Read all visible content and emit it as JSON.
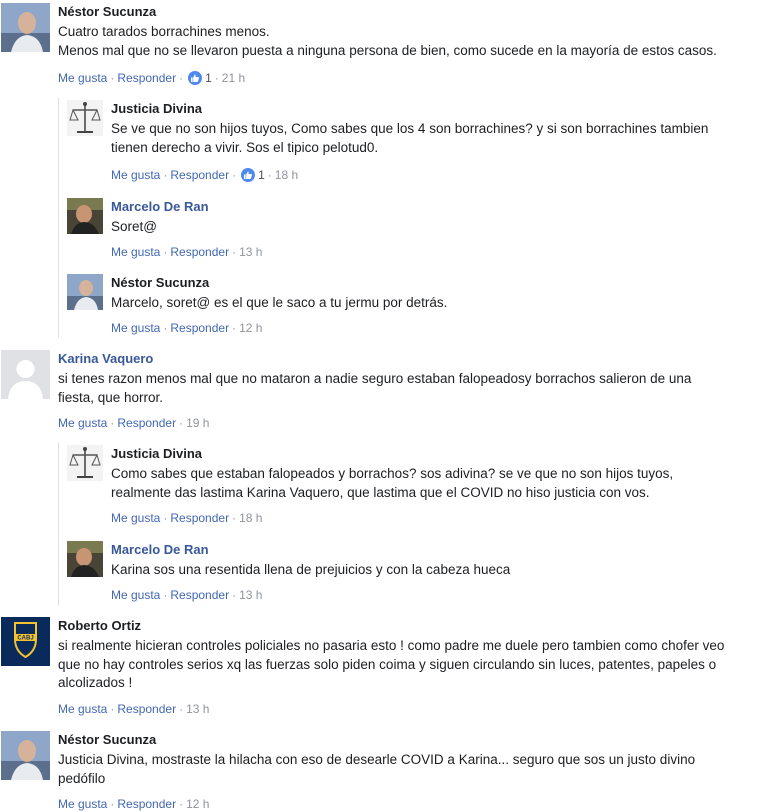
{
  "comments": [
    {
      "author": "Néstor Sucunza",
      "lines": [
        "Cuatro tarados borrachines menos.",
        "Menos mal que no se llevaron puesta a ninguna persona de bien, como sucede en la mayoría de estos casos."
      ],
      "like": "Me gusta",
      "reply": "Responder",
      "reactions": "1",
      "time": "21 h"
    },
    {
      "author": "Justicia Divina",
      "lines": [
        "Se ve que no son hijos tuyos, Como sabes que los 4 son borrachines? y si son borrachines tambien",
        "tienen derecho a vivir. Sos el tipico pelotud0."
      ],
      "like": "Me gusta",
      "reply": "Responder",
      "reactions": "1",
      "time": "18 h"
    },
    {
      "author": "Marcelo De Ran",
      "lines": [
        "Soret@"
      ],
      "like": "Me gusta",
      "reply": "Responder",
      "time": "13 h"
    },
    {
      "author": "Néstor Sucunza",
      "lines": [
        "Marcelo, soret@ es el que le saco a tu jermu por detrás."
      ],
      "like": "Me gusta",
      "reply": "Responder",
      "time": "12 h"
    },
    {
      "author": "Karina Vaquero",
      "lines": [
        "si tenes razon menos mal que no mataron a nadie seguro estaban falopeadosy borrachos salieron de una",
        "fiesta, que horror."
      ],
      "like": "Me gusta",
      "reply": "Responder",
      "time": "19 h"
    },
    {
      "author": "Justicia Divina",
      "lines": [
        "Como sabes que estaban falopeados y borrachos? sos adivina? se ve que no son hijos tuyos,",
        "realmente das lastima Karina Vaquero, que lastima que el COVID no hiso justicia con vos."
      ],
      "like": "Me gusta",
      "reply": "Responder",
      "time": "18 h"
    },
    {
      "author": "Marcelo De Ran",
      "lines": [
        "Karina sos una resentida llena de prejuicios y con la cabeza hueca"
      ],
      "like": "Me gusta",
      "reply": "Responder",
      "time": "13 h"
    },
    {
      "author": "Roberto Ortiz",
      "lines": [
        "si realmente hicieran controles policiales no pasaria esto ! como padre me duele pero tambien como chofer veo",
        "que no hay controles serios xq las fuerzas solo piden coima y siguen circulando sin luces, patentes, papeles o",
        "alcolizados !"
      ],
      "like": "Me gusta",
      "reply": "Responder",
      "time": "13 h",
      "avatar_text": "CABJ"
    },
    {
      "author": "Néstor Sucunza",
      "lines": [
        "Justicia Divina, mostraste la hilacha con eso de desearle COVID a Karina... seguro que sos un justo divino",
        "pedófilo"
      ],
      "like": "Me gusta",
      "reply": "Responder",
      "time": "12 h"
    }
  ],
  "separator": "·",
  "colors": {
    "link": "#4267b2",
    "name_blue": "#385898",
    "meta": "#90949c",
    "like_badge": "#4f89f0"
  }
}
